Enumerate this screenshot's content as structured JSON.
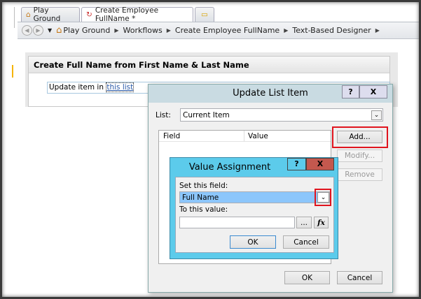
{
  "tabs": [
    {
      "label": "Play Ground"
    },
    {
      "label": "Create Employee FullName *"
    }
  ],
  "breadcrumb": [
    "Play Ground",
    "Workflows",
    "Create Employee FullName",
    "Text-Based Designer"
  ],
  "step": {
    "title": "Create Full Name from First Name & Last Name",
    "action_prefix": "Update item in",
    "action_link": "this list"
  },
  "update_dialog": {
    "title": "Update List Item",
    "help": "?",
    "close": "X",
    "list_label": "List:",
    "list_value": "Current Item",
    "col_field": "Field",
    "col_value": "Value",
    "add": "Add...",
    "modify": "Modify...",
    "remove": "Remove",
    "ok": "OK",
    "cancel": "Cancel"
  },
  "value_dialog": {
    "title": "Value Assignment",
    "help": "?",
    "close": "X",
    "set_label": "Set this field:",
    "set_value": "Full Name",
    "to_label": "To this value:",
    "to_value": "",
    "browse": "...",
    "fx": "fx",
    "ok": "OK",
    "cancel": "Cancel"
  }
}
